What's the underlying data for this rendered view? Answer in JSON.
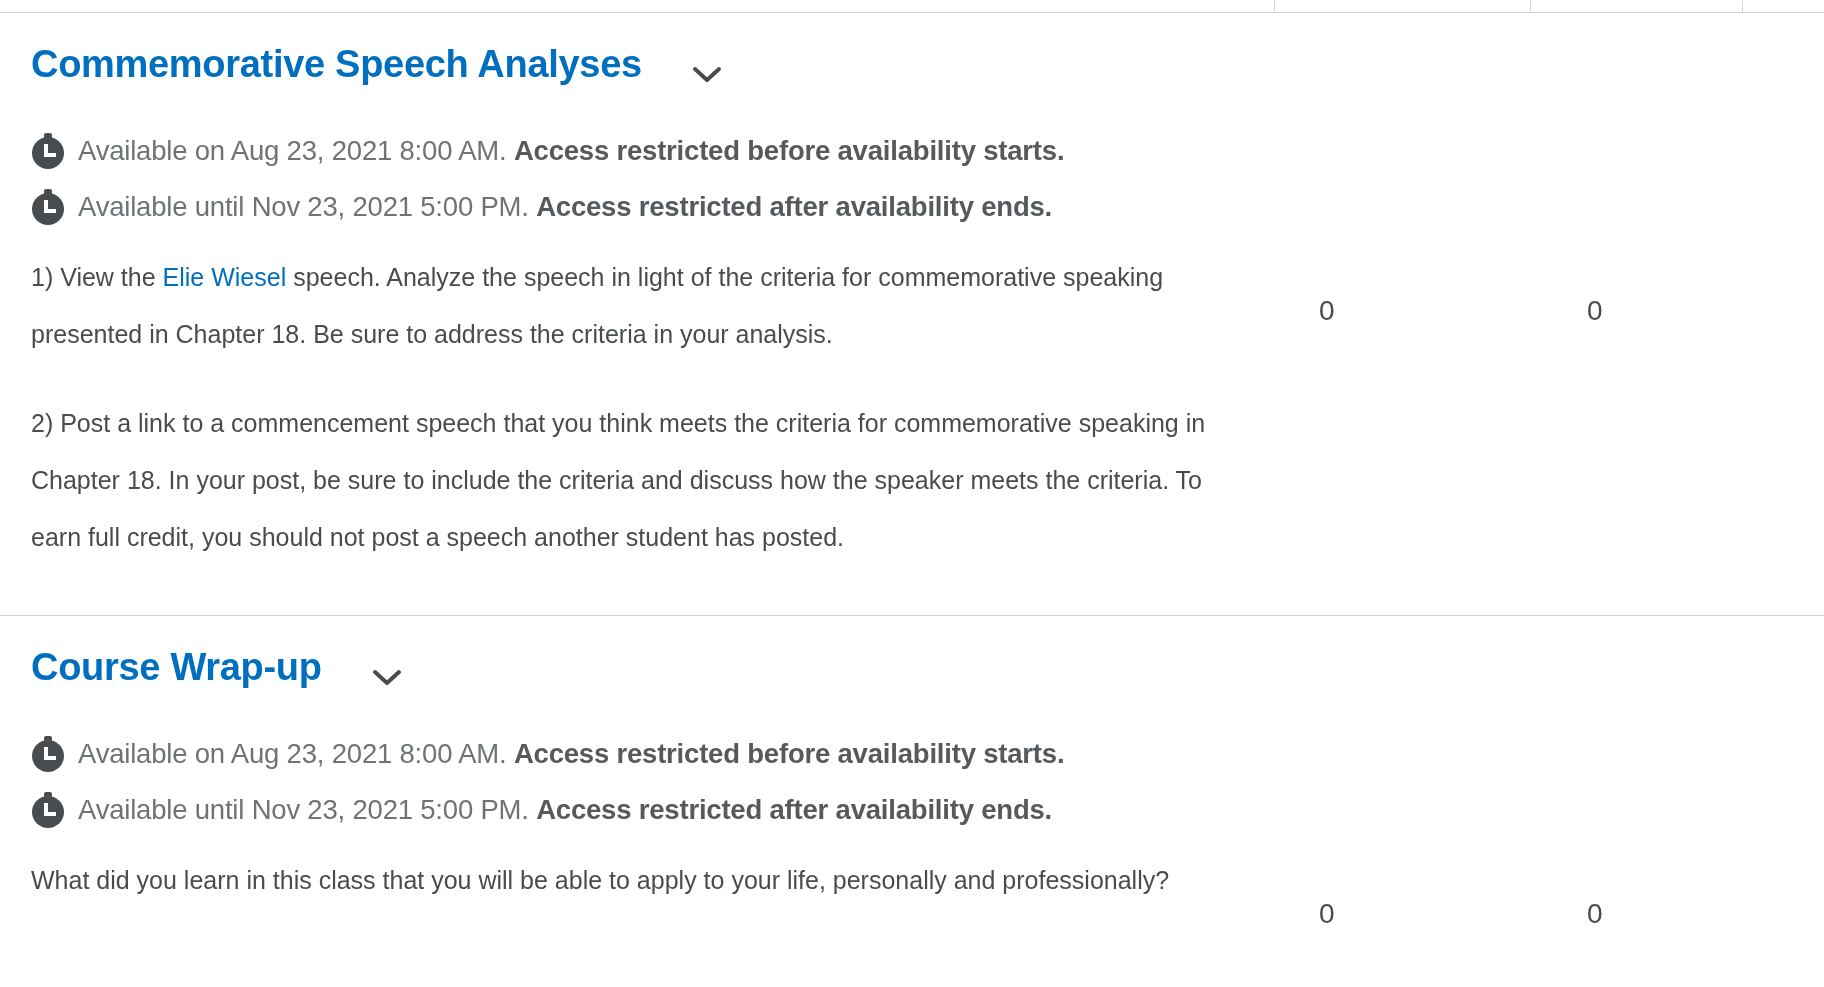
{
  "sections": [
    {
      "title": "Commemorative Speech Analyses",
      "expanded": false,
      "availability": [
        {
          "text": "Available on Aug 23, 2021 8:00 AM.",
          "note": "Access restricted before availability starts."
        },
        {
          "text": "Available until Nov 23, 2021 5:00 PM.",
          "note": "Access restricted after availability ends."
        }
      ],
      "paragraphs": [
        {
          "parts": [
            {
              "kind": "text",
              "text": "1) View the "
            },
            {
              "kind": "link",
              "text": "Elie Wiesel"
            },
            {
              "kind": "text",
              "text": " speech. Analyze the speech in light of the criteria for commemorative speaking presented in Chapter 18. Be sure to address the criteria in your analysis."
            }
          ]
        },
        {
          "parts": [
            {
              "kind": "text",
              "text": "2) Post a link to a commencement speech that you think meets the criteria for commemorative speaking in Chapter 18. In your post, be sure to include the criteria and discuss how the speaker meets the criteria. To earn full credit, you should not post a speech another student has posted."
            }
          ]
        }
      ],
      "column_1": "0",
      "column_2": "0"
    },
    {
      "title": "Course Wrap-up",
      "expanded": false,
      "availability": [
        {
          "text": "Available on Aug 23, 2021 8:00 AM.",
          "note": "Access restricted before availability starts."
        },
        {
          "text": "Available until Nov 23, 2021 5:00 PM.",
          "note": "Access restricted after availability ends."
        }
      ],
      "paragraphs": [
        {
          "parts": [
            {
              "kind": "text",
              "text": "What did you learn in this class that you will be able to apply to your life, personally and professionally?"
            }
          ]
        }
      ],
      "column_1": "0",
      "column_2": "0"
    }
  ]
}
